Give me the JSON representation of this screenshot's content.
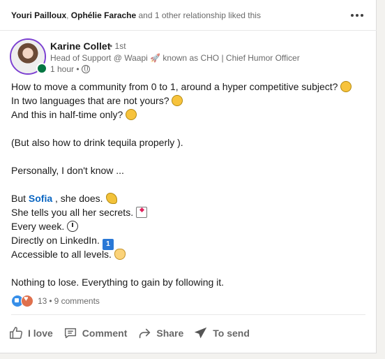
{
  "header": {
    "liker_1": "Youri Pailloux",
    "separator": ", ",
    "liker_2": "Ophélie Farache",
    "rest": " and 1 other relationship liked this"
  },
  "author": {
    "name": "Karine Collet",
    "degree": "• 1st",
    "headline": "Head of Support @ Waapi 🚀 known as CHO | Chief Humor Officer",
    "time": "1 hour •"
  },
  "post": {
    "line1": "How to move a community from 0 to 1, around a hyper competitive subject?",
    "line2": "In two languages that are not yours?",
    "line3": "And this in half-time only?",
    "line4": "(But also how to drink tequila properly ).",
    "line5": "Personally, I don't know ...",
    "line6_pre": "But ",
    "mention": "Sofia",
    "line6_post": " , she does.",
    "line7": "She tells you all her secrets.",
    "line8": "Every week.",
    "line9": "Directly on LinkedIn.",
    "line10": "Accessible to all levels.",
    "line11": "Nothing to lose. Everything to gain by following it.",
    "badge_one": "1"
  },
  "counts": {
    "reactions": "13",
    "dot": "•",
    "comments": "9 comments"
  },
  "actions": {
    "love": "I love",
    "comment": "Comment",
    "share": "Share",
    "send": "To send"
  },
  "icons": {
    "more": "more-icon",
    "globe": "globe-icon",
    "like_reaction": "like-reaction-icon",
    "love_reaction": "love-reaction-icon",
    "thumb": "thumb-up-icon",
    "comment": "comment-icon",
    "share": "share-icon",
    "send": "send-icon"
  },
  "colors": {
    "link": "#0a66c2",
    "online": "#057642",
    "like": "#378fe9",
    "love": "#df704d"
  }
}
